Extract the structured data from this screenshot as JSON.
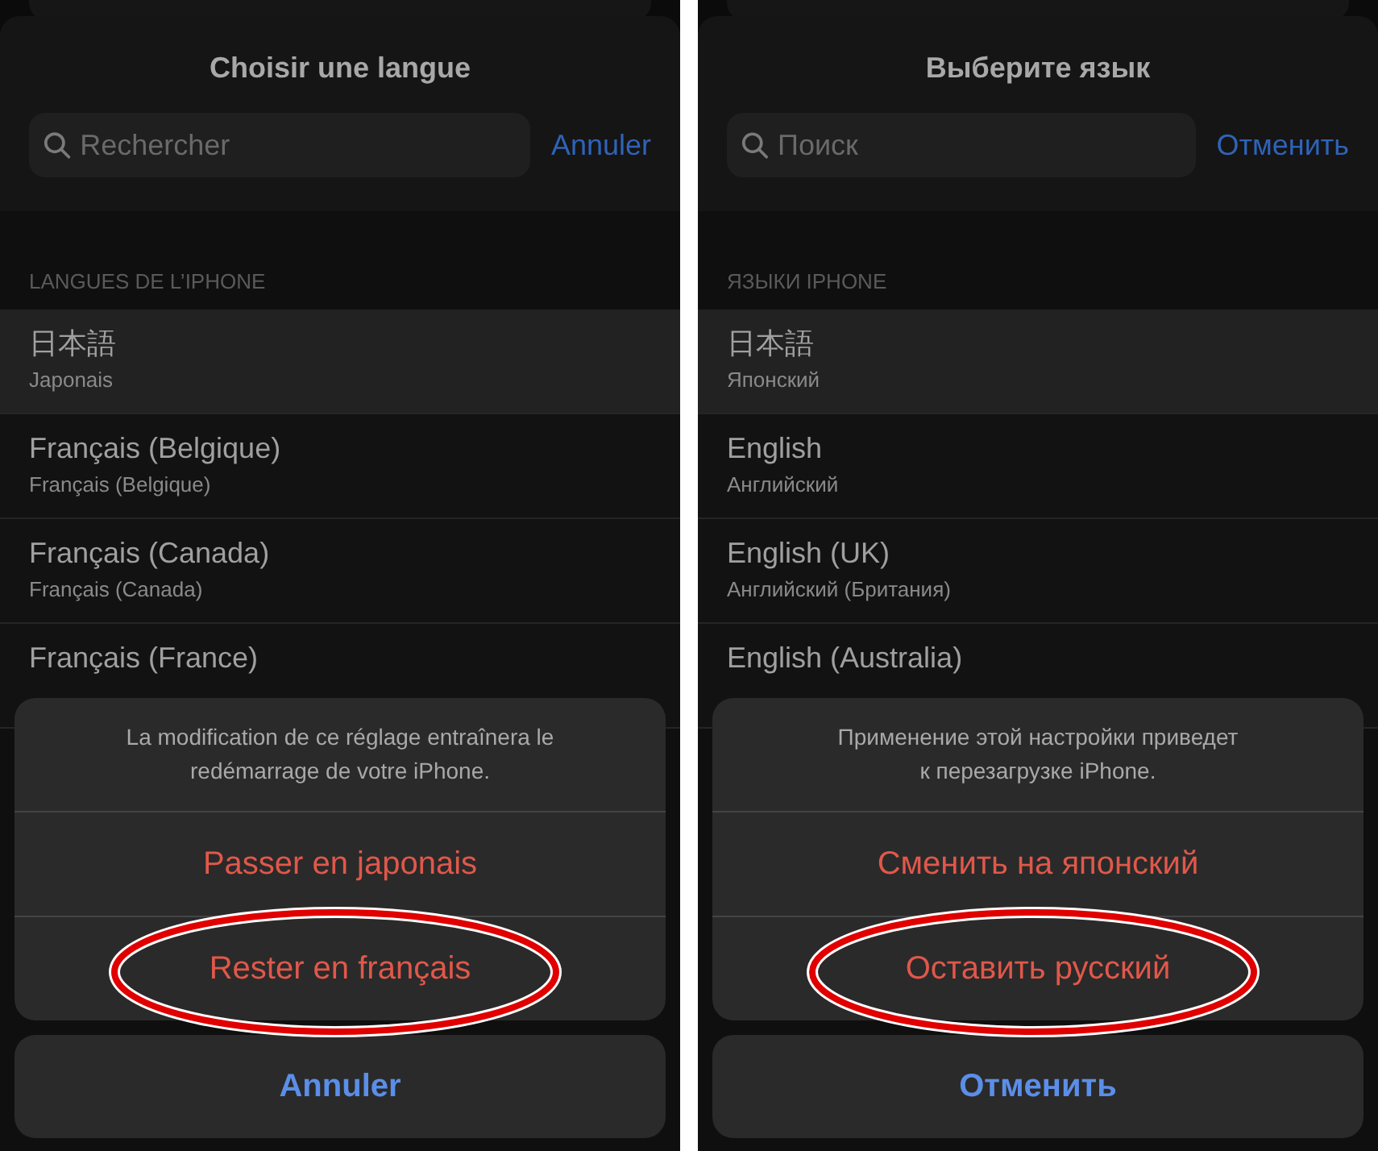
{
  "panels": [
    {
      "title": "Choisir une langue",
      "search": {
        "placeholder": "Rechercher"
      },
      "cancel_link": "Annuler",
      "section_header": "LANGUES DE L’IPHONE",
      "rows": [
        {
          "title": "日本語",
          "subtitle": "Japonais",
          "selected": true
        },
        {
          "title": "Français (Belgique)",
          "subtitle": "Français (Belgique)",
          "selected": false
        },
        {
          "title": "Français (Canada)",
          "subtitle": "Français (Canada)",
          "selected": false
        },
        {
          "title": "Français (France)",
          "selected": false
        }
      ],
      "alert": {
        "message": "La modification de ce réglage entraînera le\nredémarrage de votre iPhone.",
        "actions": [
          {
            "label": "Passer en japonais",
            "highlighted": false
          },
          {
            "label": "Rester en français",
            "highlighted": true
          }
        ]
      },
      "cancel_button": "Annuler"
    },
    {
      "title": "Выберите язык",
      "search": {
        "placeholder": "Поиск"
      },
      "cancel_link": "Отменить",
      "section_header": "ЯЗЫКИ IPHONE",
      "rows": [
        {
          "title": "日本語",
          "subtitle": "Японский",
          "selected": true
        },
        {
          "title": "English",
          "subtitle": "Английский",
          "selected": false
        },
        {
          "title": "English (UK)",
          "subtitle": "Английский (Британия)",
          "selected": false
        },
        {
          "title": "English (Australia)",
          "selected": false
        }
      ],
      "alert": {
        "message": "Применение этой настройки приведет\nк перезагрузке iPhone.",
        "actions": [
          {
            "label": "Сменить на японский",
            "highlighted": false
          },
          {
            "label": "Оставить русский",
            "highlighted": true
          }
        ]
      },
      "cancel_button": "Отменить"
    }
  ]
}
